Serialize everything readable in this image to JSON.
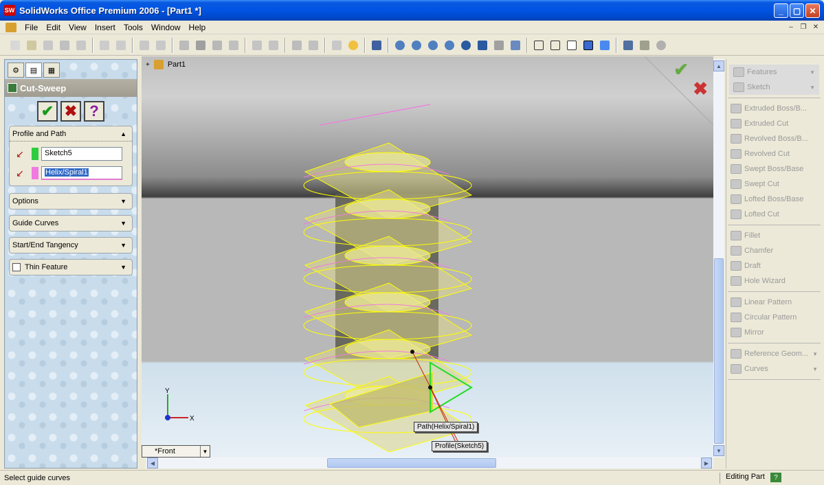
{
  "window": {
    "title": "SolidWorks Office Premium 2006 - [Part1 *]",
    "app_badge": "SW"
  },
  "menu": [
    "File",
    "Edit",
    "View",
    "Insert",
    "Tools",
    "Window",
    "Help"
  ],
  "property_manager": {
    "title": "Cut-Sweep",
    "ok": "✔",
    "cancel": "✖",
    "help": "?",
    "profile_and_path": {
      "label": "Profile and Path",
      "profile_value": "Sketch5",
      "profile_color": "#2ecc40",
      "path_value": "Helix/Spiral1",
      "path_color": "#f07ae0"
    },
    "options_label": "Options",
    "guide_curves_label": "Guide Curves",
    "tangency_label": "Start/End Tangency",
    "thin_feature_label": "Thin Feature"
  },
  "graphics": {
    "tree_root": "Part1",
    "view_name": "*Front",
    "path_callout": "Path(Helix/Spiral1)",
    "profile_callout": "Profile(Sketch5)",
    "axis_x": "X",
    "axis_y": "Y",
    "helix_color": "#f07ae0",
    "preview_color": "#ffff00"
  },
  "task_panel": {
    "top": [
      "Features",
      "Sketch"
    ],
    "features": [
      "Extruded Boss/B...",
      "Extruded Cut",
      "Revolved Boss/B...",
      "Revolved Cut",
      "Swept Boss/Base",
      "Swept Cut",
      "Lofted Boss/Base",
      "Lofted Cut"
    ],
    "features2": [
      "Fillet",
      "Chamfer",
      "Draft",
      "Hole Wizard"
    ],
    "patterns": [
      "Linear Pattern",
      "Circular Pattern",
      "Mirror"
    ],
    "bottom": [
      "Reference Geom...",
      "Curves"
    ]
  },
  "status": {
    "message": "Select guide curves",
    "mode": "Editing Part",
    "help_badge": "?"
  }
}
